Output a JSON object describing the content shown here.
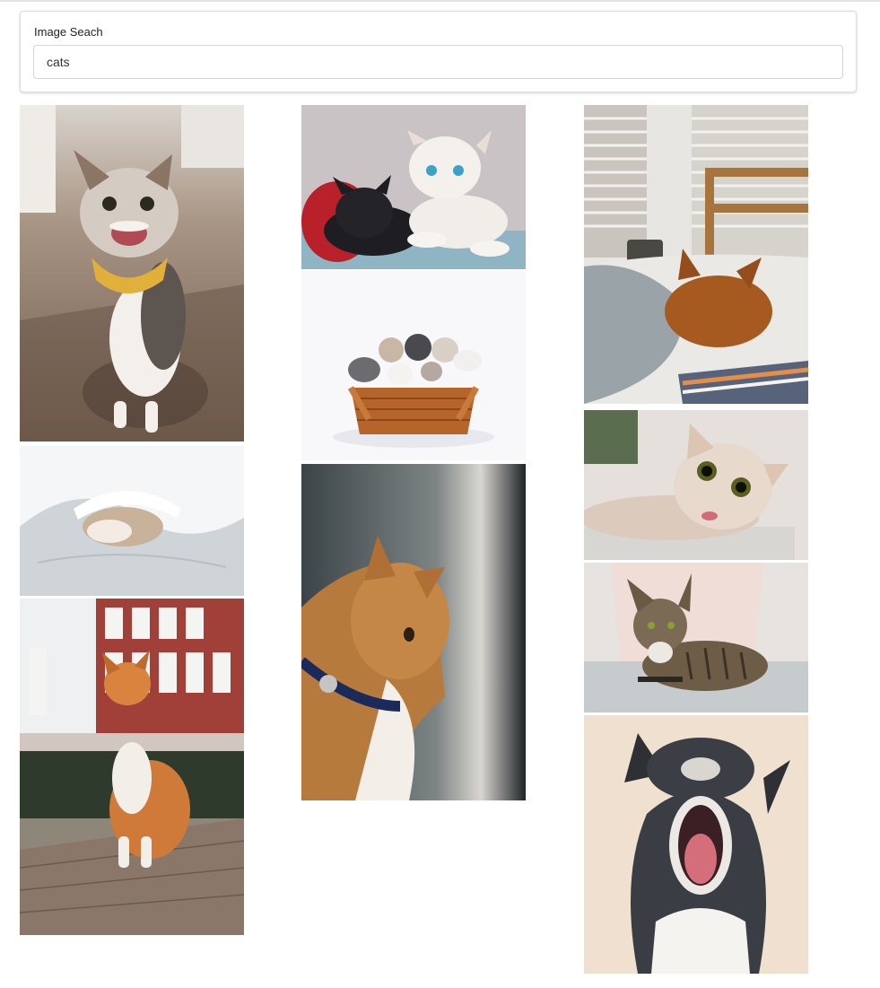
{
  "search": {
    "label": "Image Seach",
    "value": "cats"
  },
  "gallery": {
    "images": [
      {
        "subject": "cat-wearing-yellow-bandana-meowing"
      },
      {
        "subject": "cat-hiding-under-white-duvet"
      },
      {
        "subject": "orange-tabby-cat-sitting-on-brick-street"
      },
      {
        "subject": "black-and-white-kittens-cuddling"
      },
      {
        "subject": "kittens-in-wicker-basket"
      },
      {
        "subject": "orange-cat-with-blue-collar-profile"
      },
      {
        "subject": "ginger-cat-sleeping-on-bed-by-window"
      },
      {
        "subject": "surprised-cream-cat-lying-down"
      },
      {
        "subject": "tabby-cat-lying-on-sofa"
      },
      {
        "subject": "gray-and-white-cat-yawning"
      }
    ]
  },
  "colors": {
    "card_border": "#dcdcdc",
    "input_border": "#d5d5d5"
  }
}
